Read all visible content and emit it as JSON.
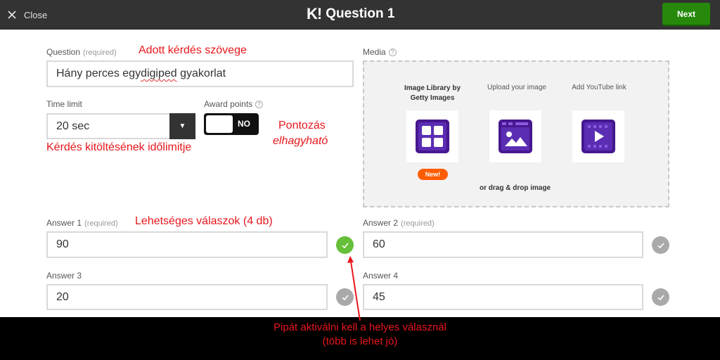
{
  "topbar": {
    "close_label": "Close",
    "logo": "K!",
    "title": "Question 1",
    "next_label": "Next",
    "next_color": "#26890c"
  },
  "question": {
    "label": "Question",
    "required": "(required)",
    "value": "Hány perces egy digiped gyakorlat",
    "value_parts": [
      "Hány perces egy ",
      "digiped",
      " gyakorlat"
    ],
    "annotation": "Adott kérdés szövege"
  },
  "time_limit": {
    "label": "Time limit",
    "selected": "20 sec",
    "annotation": "Kérdés kitöltésének időlimitje"
  },
  "award_points": {
    "label": "Award points",
    "toggle_state": "NO",
    "annotation_line1": "Pontozás",
    "annotation_line2": "elhagyható"
  },
  "media": {
    "label": "Media",
    "options": [
      {
        "label_line1": "Image Library by",
        "label_line2": "Getty Images",
        "icon": "grid-icon",
        "badge": "New!"
      },
      {
        "label_line1": "Upload your image",
        "label_line2": "",
        "icon": "image-upload-icon"
      },
      {
        "label_line1": "Add YouTube link",
        "label_line2": "",
        "icon": "video-icon"
      }
    ],
    "drag_text": "or drag & drop image"
  },
  "answers": [
    {
      "label": "Answer 1",
      "required": "(required)",
      "value": "90",
      "correct": true
    },
    {
      "label": "Answer 2",
      "required": "(required)",
      "value": "60",
      "correct": false
    },
    {
      "label": "Answer 3",
      "required": "",
      "value": "20",
      "correct": false
    },
    {
      "label": "Answer 4",
      "required": "",
      "value": "45",
      "correct": false
    }
  ],
  "answers_annotation": "Lehetséges válaszok (4 db)",
  "bottom_note": {
    "line1": "Pipát aktiválni kell a helyes válasznál",
    "line2": "(több is lehet jó)"
  },
  "colors": {
    "correct_green": "#66bf39",
    "inactive_gray": "#a9a9a9",
    "media_purple": "#46178f",
    "annotation_red": "#e8161c",
    "new_badge_orange": "#ff5c00"
  }
}
